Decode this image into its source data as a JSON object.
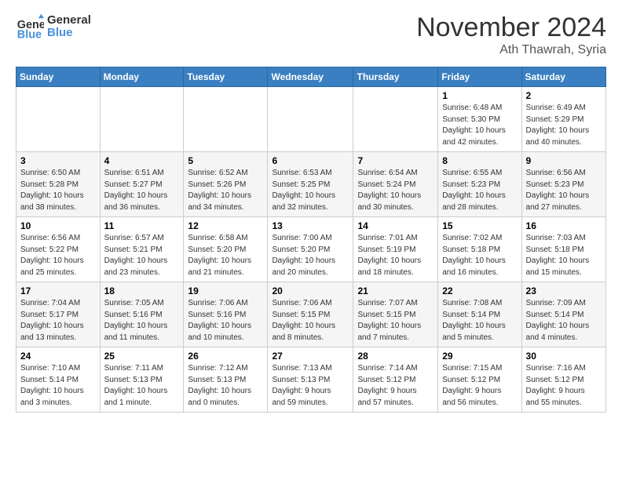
{
  "header": {
    "logo_line1": "General",
    "logo_line2": "Blue",
    "month": "November 2024",
    "location": "Ath Thawrah, Syria"
  },
  "weekdays": [
    "Sunday",
    "Monday",
    "Tuesday",
    "Wednesday",
    "Thursday",
    "Friday",
    "Saturday"
  ],
  "weeks": [
    [
      {
        "day": "",
        "info": ""
      },
      {
        "day": "",
        "info": ""
      },
      {
        "day": "",
        "info": ""
      },
      {
        "day": "",
        "info": ""
      },
      {
        "day": "",
        "info": ""
      },
      {
        "day": "1",
        "info": "Sunrise: 6:48 AM\nSunset: 5:30 PM\nDaylight: 10 hours\nand 42 minutes."
      },
      {
        "day": "2",
        "info": "Sunrise: 6:49 AM\nSunset: 5:29 PM\nDaylight: 10 hours\nand 40 minutes."
      }
    ],
    [
      {
        "day": "3",
        "info": "Sunrise: 6:50 AM\nSunset: 5:28 PM\nDaylight: 10 hours\nand 38 minutes."
      },
      {
        "day": "4",
        "info": "Sunrise: 6:51 AM\nSunset: 5:27 PM\nDaylight: 10 hours\nand 36 minutes."
      },
      {
        "day": "5",
        "info": "Sunrise: 6:52 AM\nSunset: 5:26 PM\nDaylight: 10 hours\nand 34 minutes."
      },
      {
        "day": "6",
        "info": "Sunrise: 6:53 AM\nSunset: 5:25 PM\nDaylight: 10 hours\nand 32 minutes."
      },
      {
        "day": "7",
        "info": "Sunrise: 6:54 AM\nSunset: 5:24 PM\nDaylight: 10 hours\nand 30 minutes."
      },
      {
        "day": "8",
        "info": "Sunrise: 6:55 AM\nSunset: 5:23 PM\nDaylight: 10 hours\nand 28 minutes."
      },
      {
        "day": "9",
        "info": "Sunrise: 6:56 AM\nSunset: 5:23 PM\nDaylight: 10 hours\nand 27 minutes."
      }
    ],
    [
      {
        "day": "10",
        "info": "Sunrise: 6:56 AM\nSunset: 5:22 PM\nDaylight: 10 hours\nand 25 minutes."
      },
      {
        "day": "11",
        "info": "Sunrise: 6:57 AM\nSunset: 5:21 PM\nDaylight: 10 hours\nand 23 minutes."
      },
      {
        "day": "12",
        "info": "Sunrise: 6:58 AM\nSunset: 5:20 PM\nDaylight: 10 hours\nand 21 minutes."
      },
      {
        "day": "13",
        "info": "Sunrise: 7:00 AM\nSunset: 5:20 PM\nDaylight: 10 hours\nand 20 minutes."
      },
      {
        "day": "14",
        "info": "Sunrise: 7:01 AM\nSunset: 5:19 PM\nDaylight: 10 hours\nand 18 minutes."
      },
      {
        "day": "15",
        "info": "Sunrise: 7:02 AM\nSunset: 5:18 PM\nDaylight: 10 hours\nand 16 minutes."
      },
      {
        "day": "16",
        "info": "Sunrise: 7:03 AM\nSunset: 5:18 PM\nDaylight: 10 hours\nand 15 minutes."
      }
    ],
    [
      {
        "day": "17",
        "info": "Sunrise: 7:04 AM\nSunset: 5:17 PM\nDaylight: 10 hours\nand 13 minutes."
      },
      {
        "day": "18",
        "info": "Sunrise: 7:05 AM\nSunset: 5:16 PM\nDaylight: 10 hours\nand 11 minutes."
      },
      {
        "day": "19",
        "info": "Sunrise: 7:06 AM\nSunset: 5:16 PM\nDaylight: 10 hours\nand 10 minutes."
      },
      {
        "day": "20",
        "info": "Sunrise: 7:06 AM\nSunset: 5:15 PM\nDaylight: 10 hours\nand 8 minutes."
      },
      {
        "day": "21",
        "info": "Sunrise: 7:07 AM\nSunset: 5:15 PM\nDaylight: 10 hours\nand 7 minutes."
      },
      {
        "day": "22",
        "info": "Sunrise: 7:08 AM\nSunset: 5:14 PM\nDaylight: 10 hours\nand 5 minutes."
      },
      {
        "day": "23",
        "info": "Sunrise: 7:09 AM\nSunset: 5:14 PM\nDaylight: 10 hours\nand 4 minutes."
      }
    ],
    [
      {
        "day": "24",
        "info": "Sunrise: 7:10 AM\nSunset: 5:14 PM\nDaylight: 10 hours\nand 3 minutes."
      },
      {
        "day": "25",
        "info": "Sunrise: 7:11 AM\nSunset: 5:13 PM\nDaylight: 10 hours\nand 1 minute."
      },
      {
        "day": "26",
        "info": "Sunrise: 7:12 AM\nSunset: 5:13 PM\nDaylight: 10 hours\nand 0 minutes."
      },
      {
        "day": "27",
        "info": "Sunrise: 7:13 AM\nSunset: 5:13 PM\nDaylight: 9 hours\nand 59 minutes."
      },
      {
        "day": "28",
        "info": "Sunrise: 7:14 AM\nSunset: 5:12 PM\nDaylight: 9 hours\nand 57 minutes."
      },
      {
        "day": "29",
        "info": "Sunrise: 7:15 AM\nSunset: 5:12 PM\nDaylight: 9 hours\nand 56 minutes."
      },
      {
        "day": "30",
        "info": "Sunrise: 7:16 AM\nSunset: 5:12 PM\nDaylight: 9 hours\nand 55 minutes."
      }
    ]
  ]
}
